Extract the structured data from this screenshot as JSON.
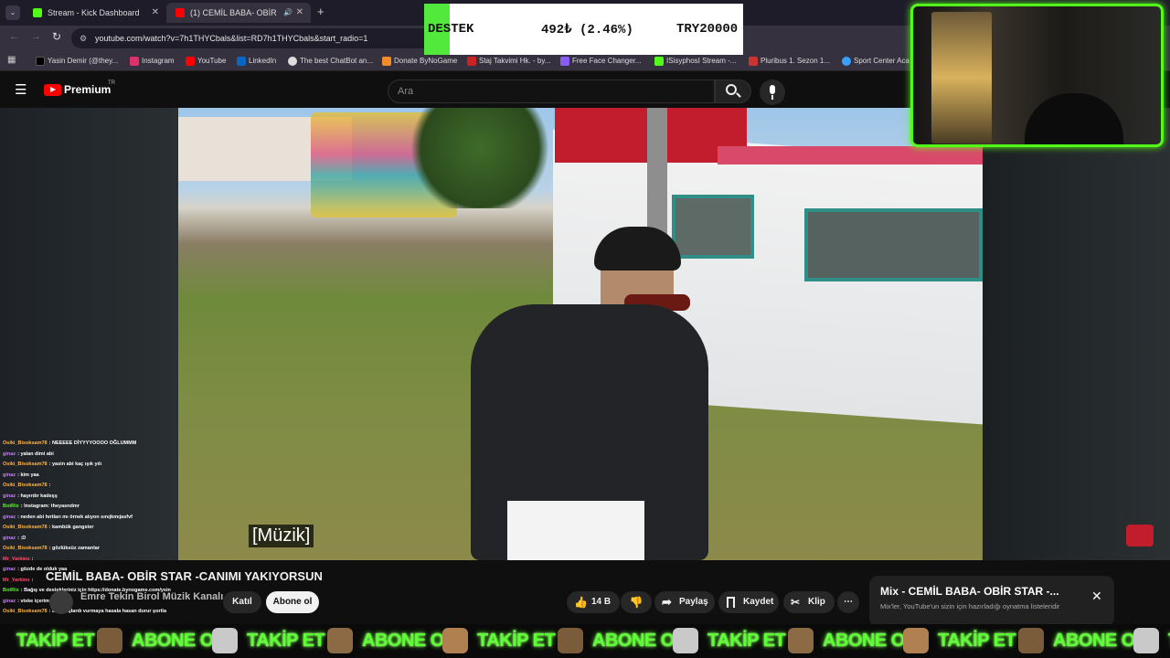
{
  "browser": {
    "tabs": [
      {
        "label": "Stream - Kick Dashboard",
        "color": "#53fc18"
      },
      {
        "label": "(1) CEMİL BABA- OBİR STAR",
        "color": "#ff0000"
      }
    ],
    "url": "youtube.com/watch?v=7h1THYCbals&list=RD7h1THYCbals&start_radio=1",
    "bookmarks": [
      {
        "label": "Yasin Demir (@they...",
        "color": "#000000"
      },
      {
        "label": "Instagram",
        "color": "#e1306c"
      },
      {
        "label": "YouTube",
        "color": "#ff0000"
      },
      {
        "label": "LinkedIn",
        "color": "#0a66c2"
      },
      {
        "label": "The best ChatBot an...",
        "color": "#dddddd"
      },
      {
        "label": "Donate ByNoGame",
        "color": "#f28c28"
      },
      {
        "label": "Staj Takvimi Hk. - by...",
        "color": "#cc2222"
      },
      {
        "label": "Free Face Changer...",
        "color": "#8a5cf6"
      },
      {
        "label": "ISisyphosI Stream -...",
        "color": "#53fc18"
      },
      {
        "label": "Pluribus 1. Sezon 1...",
        "color": "#cc3333"
      },
      {
        "label": "Sport Center Aca",
        "color": "#3aa0ff"
      }
    ]
  },
  "youtube": {
    "logo": "Premium",
    "logo_region": "TR",
    "search_placeholder": "Ara",
    "video_subtitle": "[Müzik]",
    "title": "CEMİL BABA- OBİR STAR -CANIMI YAKIYORSUN",
    "channel": "Emre Tekin Birol Müzik Kanalı",
    "join_label": "Katıl",
    "subscribe_label": "Abone ol",
    "like_count": "14 B",
    "share_label": "Paylaş",
    "save_label": "Kaydet",
    "clip_label": "Klip",
    "mix_title": "Mix - CEMİL BABA- OBİR STAR -...",
    "mix_subtitle": "Mix'ler, YouTube'un sizin için hazırladığı oynatma listeleridir"
  },
  "donation": {
    "label": "DESTEK",
    "amount": "492₺ (2.46%)",
    "goal": "TRY20000",
    "progress_percent": 2.46
  },
  "chat": [
    {
      "user": "Osiki_Bisoksam78",
      "color": "#ffb347",
      "msg": "NEEEEE DİYYYYOOOO OĞLUMMM"
    },
    {
      "user": "ginaz",
      "color": "#c77dff",
      "msg": "yalan dimi abi"
    },
    {
      "user": "Osiki_Bisoksam78",
      "color": "#ffb347",
      "msg": "yasin abi kaç ışık yılı"
    },
    {
      "user": "ginaz",
      "color": "#c77dff",
      "msg": "kim yaa"
    },
    {
      "user": "Osiki_Bisoksam78",
      "color": "#ffb347",
      "msg": ""
    },
    {
      "user": "ginaz",
      "color": "#c77dff",
      "msg": "hayırdır kadeşş"
    },
    {
      "user": "BotRix",
      "color": "#53fc18",
      "msg": "Instagram: theyasndmr"
    },
    {
      "user": "ginaz",
      "color": "#c77dff",
      "msg": "neden abi hırtları mı örnek alıyon sınıjkmıjasfvf"
    },
    {
      "user": "Osiki_Bisoksam78",
      "color": "#ffb347",
      "msg": "kambük gangster"
    },
    {
      "user": "ginaz",
      "color": "#c77dff",
      "msg": ":D"
    },
    {
      "user": "Osiki_Bisoksam78",
      "color": "#ffb347",
      "msg": "gözlüksüz zamanlar"
    },
    {
      "user": "Mr_Yarkino",
      "color": "#ff4d6d",
      "msg": ""
    },
    {
      "user": "ginaz",
      "color": "#c77dff",
      "msg": "gözde de olduk yaa"
    },
    {
      "user": "Mr_Yarkino",
      "color": "#ff4d6d",
      "msg": ""
    },
    {
      "user": "BotRix",
      "color": "#53fc18",
      "msg": "Bağış ve destekleriniz için https://donate.bynogame.com/ysin"
    },
    {
      "user": "ginaz",
      "color": "#c77dff",
      "msg": "viske içerim"
    },
    {
      "user": "Osiki_Bisoksam78",
      "color": "#ffb347",
      "msg": "ben başlardı vurmaya hasala hasan durur şortla"
    }
  ],
  "ticker": {
    "items": [
      "TAKİP ET",
      "ABONE OL",
      "TAKİP ET",
      "ABONE OL",
      "TAKİP ET",
      "ABONE OL",
      "TAKİP ET",
      "ABONE OL",
      "TAKİP ET",
      "ABONE OL",
      "TAKİP ET",
      "ABONE OL"
    ]
  }
}
